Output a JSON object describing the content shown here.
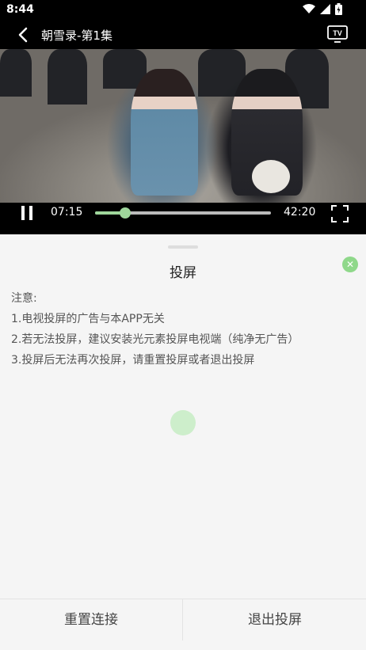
{
  "status_bar": {
    "time": "8:44"
  },
  "header": {
    "title": "朝雪录-第1集",
    "tv_icon_text": "TV"
  },
  "player": {
    "current_time": "07:15",
    "total_time": "42:20",
    "progress": 0.172
  },
  "cast_panel": {
    "title": "投屏",
    "notes": [
      "注意:",
      "1.电视投屏的广告与本APP无关",
      "2.若无法投屏，建议安装光元素投屏电视端（纯净无广告）",
      "3.投屏后无法再次投屏，请重置投屏或者退出投屏"
    ],
    "reset_label": "重置连接",
    "exit_label": "退出投屏"
  },
  "colors": {
    "accent": "#9fd69b",
    "close": "#8fd88a"
  }
}
